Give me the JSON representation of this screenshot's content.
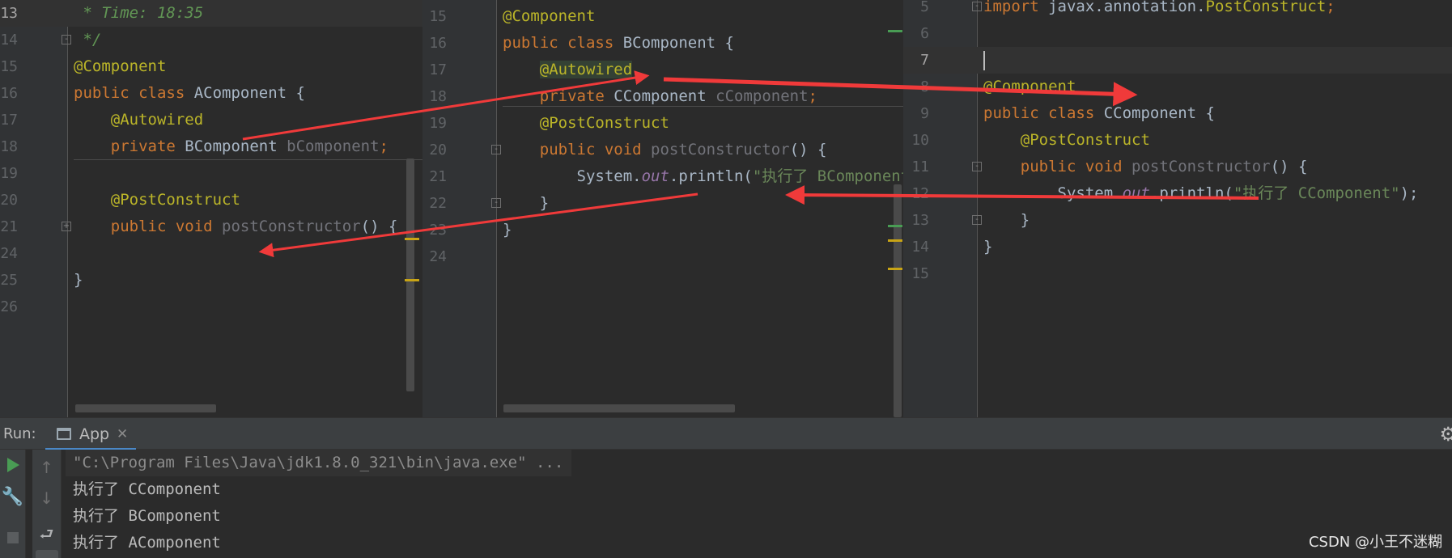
{
  "panes": [
    {
      "id": "a",
      "lines": [
        {
          "num": "13",
          "current": true,
          "tokens": [
            {
              "t": " * Time: 18:35",
              "c": "comment"
            }
          ]
        },
        {
          "num": "14",
          "fold": "-",
          "tokens": [
            {
              "t": " */",
              "c": "comment"
            }
          ]
        },
        {
          "num": "15",
          "tokens": [
            {
              "t": "@Component",
              "c": "ann"
            }
          ]
        },
        {
          "num": "16",
          "tokens": [
            {
              "t": "public class ",
              "c": "kw"
            },
            {
              "t": "AComponent {",
              "c": "cls"
            }
          ]
        },
        {
          "num": "17",
          "tokens": [
            {
              "t": "    @Autowired",
              "c": "ann"
            }
          ]
        },
        {
          "num": "18",
          "tokens": [
            {
              "t": "    private ",
              "c": "kw"
            },
            {
              "t": "BComponent ",
              "c": "cls"
            },
            {
              "t": "bComponent",
              "c": "unused"
            },
            {
              "t": ";",
              "c": "kw"
            }
          ]
        },
        {
          "num": "19",
          "tokens": []
        },
        {
          "num": "20",
          "tokens": [
            {
              "t": "    @PostConstruct",
              "c": "ann"
            }
          ]
        },
        {
          "num": "21",
          "fold": "+",
          "tokens": [
            {
              "t": "    public void ",
              "c": "kw"
            },
            {
              "t": "postConstructor",
              "c": "unused"
            },
            {
              "t": "() {",
              "c": "plain"
            }
          ]
        },
        {
          "num": "24",
          "tokens": []
        },
        {
          "num": "25",
          "tokens": [
            {
              "t": "}",
              "c": "plain"
            }
          ]
        },
        {
          "num": "26",
          "tokens": []
        }
      ]
    },
    {
      "id": "b",
      "lines": [
        {
          "num": "15",
          "tokens": [
            {
              "t": "@Component",
              "c": "ann"
            }
          ]
        },
        {
          "num": "16",
          "tokens": [
            {
              "t": "public class ",
              "c": "kw"
            },
            {
              "t": "BComponent {",
              "c": "cls"
            }
          ]
        },
        {
          "num": "17",
          "tokens": [
            {
              "t": "    ",
              "c": "plain"
            },
            {
              "t": "@Autowired",
              "c": "ann",
              "hl": true
            }
          ]
        },
        {
          "num": "18",
          "tokens": [
            {
              "t": "    private ",
              "c": "kw"
            },
            {
              "t": "CComponent ",
              "c": "cls"
            },
            {
              "t": "cComponent",
              "c": "unused"
            },
            {
              "t": ";",
              "c": "kw"
            }
          ]
        },
        {
          "num": "19",
          "tokens": [
            {
              "t": "    @PostConstruct",
              "c": "ann"
            }
          ]
        },
        {
          "num": "20",
          "fold": "-",
          "tokens": [
            {
              "t": "    public void ",
              "c": "kw"
            },
            {
              "t": "postConstructor",
              "c": "unused"
            },
            {
              "t": "() {",
              "c": "plain"
            }
          ]
        },
        {
          "num": "21",
          "tokens": [
            {
              "t": "        System.",
              "c": "plain"
            },
            {
              "t": "out",
              "c": "static"
            },
            {
              "t": ".println(",
              "c": "plain"
            },
            {
              "t": "\"执行了 BComponent\"",
              "c": "str"
            },
            {
              "t": ");",
              "c": "plain"
            }
          ]
        },
        {
          "num": "22",
          "fold": "-",
          "tokens": [
            {
              "t": "    }",
              "c": "plain"
            }
          ]
        },
        {
          "num": "23",
          "tokens": [
            {
              "t": "}",
              "c": "plain"
            }
          ]
        },
        {
          "num": "24",
          "tokens": []
        }
      ]
    },
    {
      "id": "c",
      "lines": [
        {
          "num": "5",
          "fold": "-",
          "tokens": [
            {
              "t": "import ",
              "c": "kw"
            },
            {
              "t": "javax.annotation.",
              "c": "plain"
            },
            {
              "t": "PostConstruct",
              "c": "ann"
            },
            {
              "t": ";",
              "c": "kw"
            }
          ]
        },
        {
          "num": "6",
          "tokens": []
        },
        {
          "num": "7",
          "current": true,
          "caret": true,
          "tokens": []
        },
        {
          "num": "8",
          "tokens": [
            {
              "t": "@Component",
              "c": "ann"
            }
          ]
        },
        {
          "num": "9",
          "tokens": [
            {
              "t": "public class ",
              "c": "kw"
            },
            {
              "t": "CComponent {",
              "c": "cls"
            }
          ]
        },
        {
          "num": "10",
          "tokens": [
            {
              "t": "    @PostConstruct",
              "c": "ann"
            }
          ]
        },
        {
          "num": "11",
          "fold": "-",
          "tokens": [
            {
              "t": "    public void ",
              "c": "kw"
            },
            {
              "t": "postConstructor",
              "c": "unused"
            },
            {
              "t": "() {",
              "c": "plain"
            }
          ]
        },
        {
          "num": "12",
          "tokens": [
            {
              "t": "        System.",
              "c": "plain"
            },
            {
              "t": "out",
              "c": "static"
            },
            {
              "t": ".println(",
              "c": "plain"
            },
            {
              "t": "\"执行了 CComponent\"",
              "c": "str"
            },
            {
              "t": ");",
              "c": "plain"
            }
          ]
        },
        {
          "num": "13",
          "fold": "-",
          "tokens": [
            {
              "t": "    }",
              "c": "plain"
            }
          ]
        },
        {
          "num": "14",
          "tokens": [
            {
              "t": "}",
              "c": "plain"
            }
          ]
        },
        {
          "num": "15",
          "tokens": []
        }
      ]
    }
  ],
  "run_panel": {
    "label": "Run:",
    "tab_label": "App",
    "tab_close": "✕",
    "gear_glyph": "⚙",
    "tool_glyphs": {
      "wrench": "🔧",
      "up": "↑",
      "down": "↓",
      "wrap": "⮐"
    },
    "command": "\"C:\\Program Files\\Java\\jdk1.8.0_321\\bin\\java.exe\" ...",
    "output": [
      "执行了 CComponent",
      "执行了 BComponent",
      "执行了 AComponent"
    ]
  },
  "watermark": "CSDN @小王不迷糊",
  "colors": {
    "arrow": "#f03a3a",
    "editor_bg": "#2b2b2b",
    "gutter_bg": "#313335",
    "keyword": "#cc7832",
    "annotation": "#bbb529",
    "string": "#6a8759",
    "comment": "#629755",
    "tab_underline": "#4a88c7",
    "run_green": "#499c54"
  }
}
